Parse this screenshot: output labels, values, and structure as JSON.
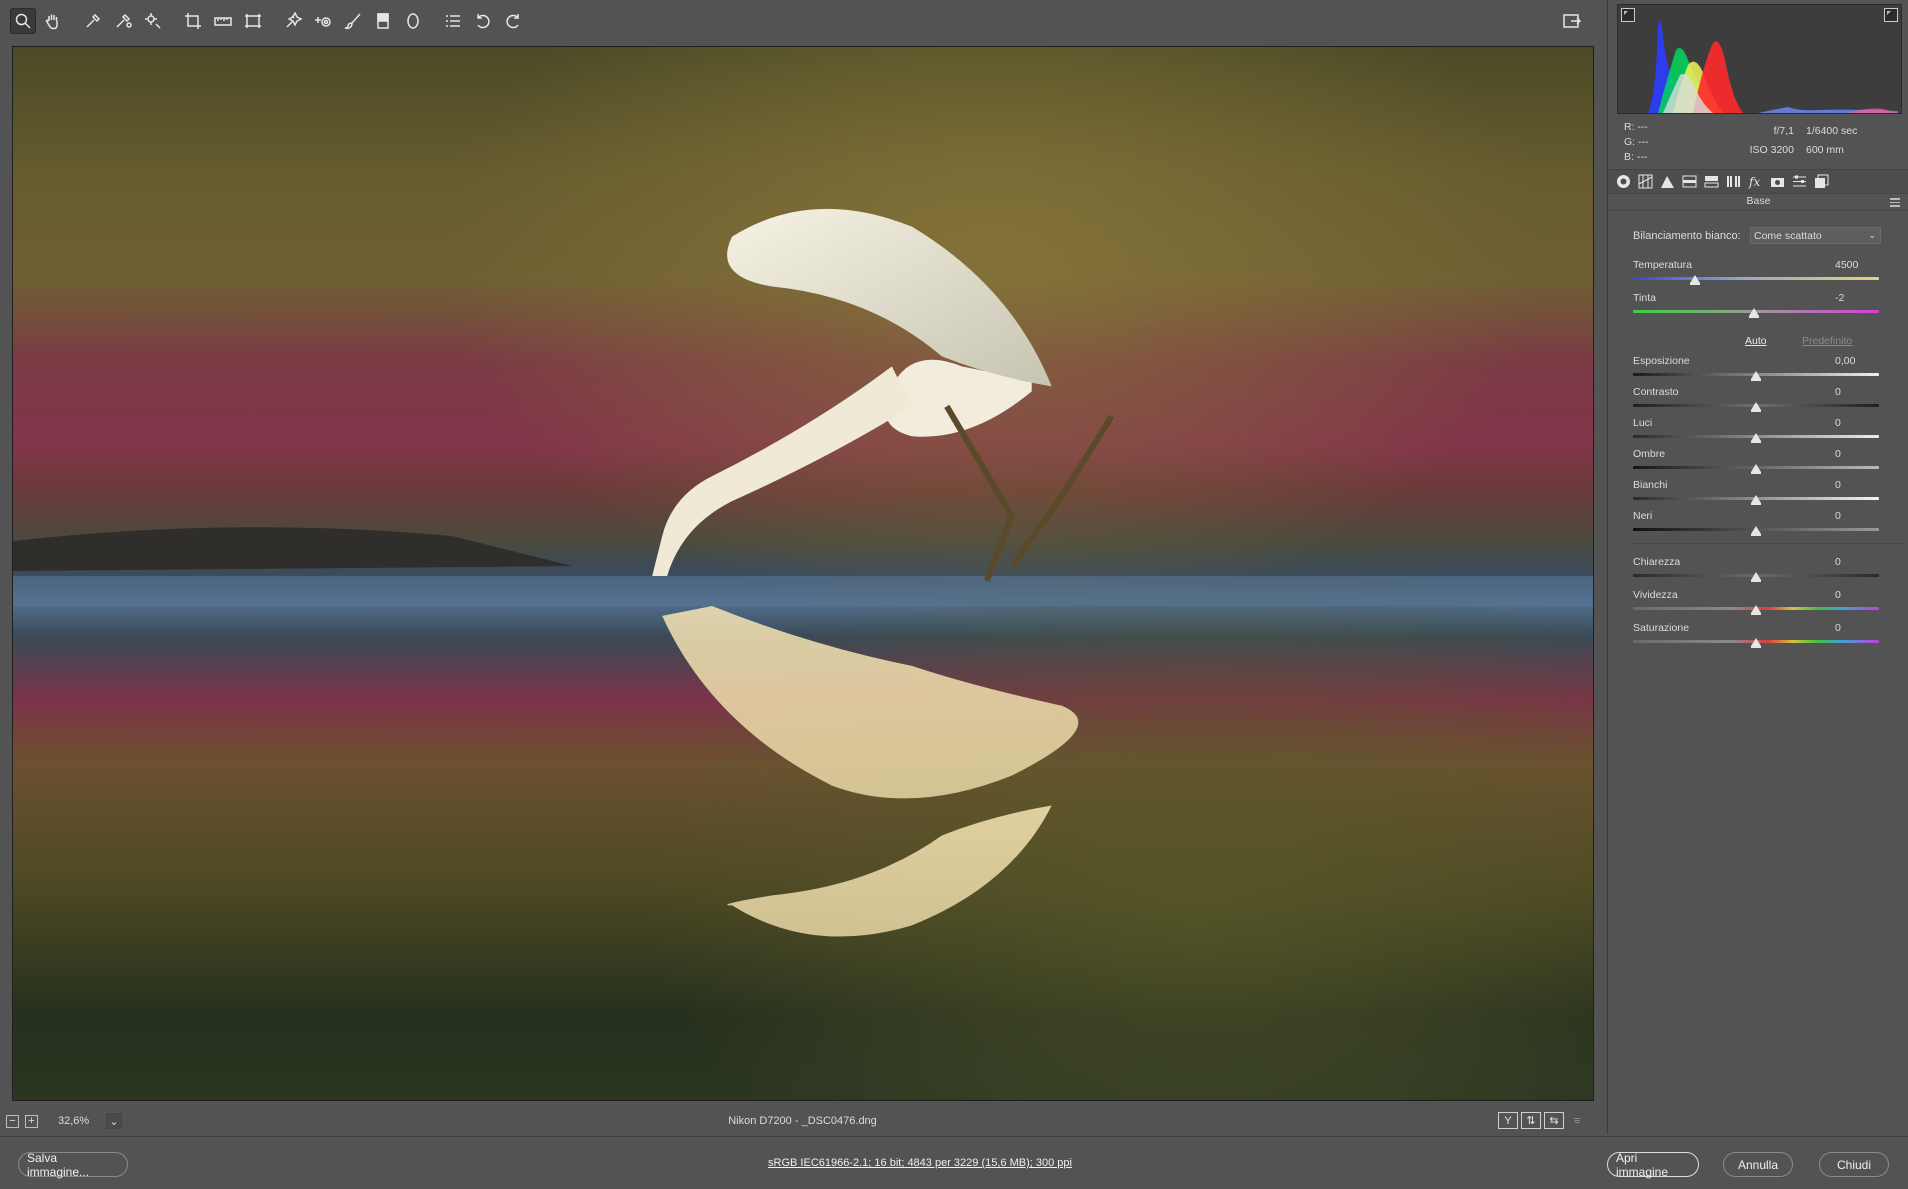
{
  "toolbar": {
    "tools": [
      {
        "icon": "zoom-tool-icon",
        "active": true
      },
      {
        "icon": "hand-tool-icon"
      },
      {
        "icon": "white-balance-eyedropper-icon"
      },
      {
        "icon": "color-sampler-icon"
      },
      {
        "icon": "targeted-adjustment-icon"
      },
      {
        "icon": "crop-tool-icon"
      },
      {
        "icon": "straighten-tool-icon"
      },
      {
        "icon": "transform-tool-icon"
      },
      {
        "icon": "spot-removal-icon"
      },
      {
        "icon": "red-eye-icon"
      },
      {
        "icon": "adjustment-brush-icon"
      },
      {
        "icon": "graduated-filter-icon"
      },
      {
        "icon": "radial-filter-icon"
      },
      {
        "icon": "preferences-icon"
      },
      {
        "icon": "rotate-left-icon"
      },
      {
        "icon": "rotate-right-icon"
      }
    ],
    "fullscreen_icon": "fullscreen-toggle-icon"
  },
  "status": {
    "zoom": "32,6%",
    "file": "Nikon D7200  -  _DSC0476.dng",
    "view_y": "Y"
  },
  "readout": {
    "r": "R:   ---",
    "g": "G:   ---",
    "b": "B:   ---",
    "aperture": "f/7,1",
    "shutter": "1/6400 sec",
    "iso": "ISO 3200",
    "focal": "600 mm"
  },
  "panel": {
    "section": "Base",
    "wb_label": "Bilanciamento bianco:",
    "wb_value": "Come scattato",
    "auto": "Auto",
    "default": "Predefinito",
    "sliders": {
      "temperatura": {
        "label": "Temperatura",
        "value": "4500",
        "pos": 0.25
      },
      "tinta": {
        "label": "Tinta",
        "value": "-2",
        "pos": 0.49
      },
      "esposizione": {
        "label": "Esposizione",
        "value": "0,00",
        "pos": 0.5
      },
      "contrasto": {
        "label": "Contrasto",
        "value": "0",
        "pos": 0.5
      },
      "luci": {
        "label": "Luci",
        "value": "0",
        "pos": 0.5
      },
      "ombre": {
        "label": "Ombre",
        "value": "0",
        "pos": 0.5
      },
      "bianchi": {
        "label": "Bianchi",
        "value": "0",
        "pos": 0.5
      },
      "neri": {
        "label": "Neri",
        "value": "0",
        "pos": 0.5
      },
      "chiarezza": {
        "label": "Chiarezza",
        "value": "0",
        "pos": 0.5
      },
      "vividezza": {
        "label": "Vividezza",
        "value": "0",
        "pos": 0.5
      },
      "saturazione": {
        "label": "Saturazione",
        "value": "0",
        "pos": 0.5
      }
    }
  },
  "bottom": {
    "save": "Salva immagine...",
    "info": "sRGB IEC61966-2.1; 16 bit; 4843 per 3229 (15,6 MB); 300 ppi",
    "open": "Apri immagine",
    "cancel": "Annulla",
    "close": "Chiudi"
  }
}
